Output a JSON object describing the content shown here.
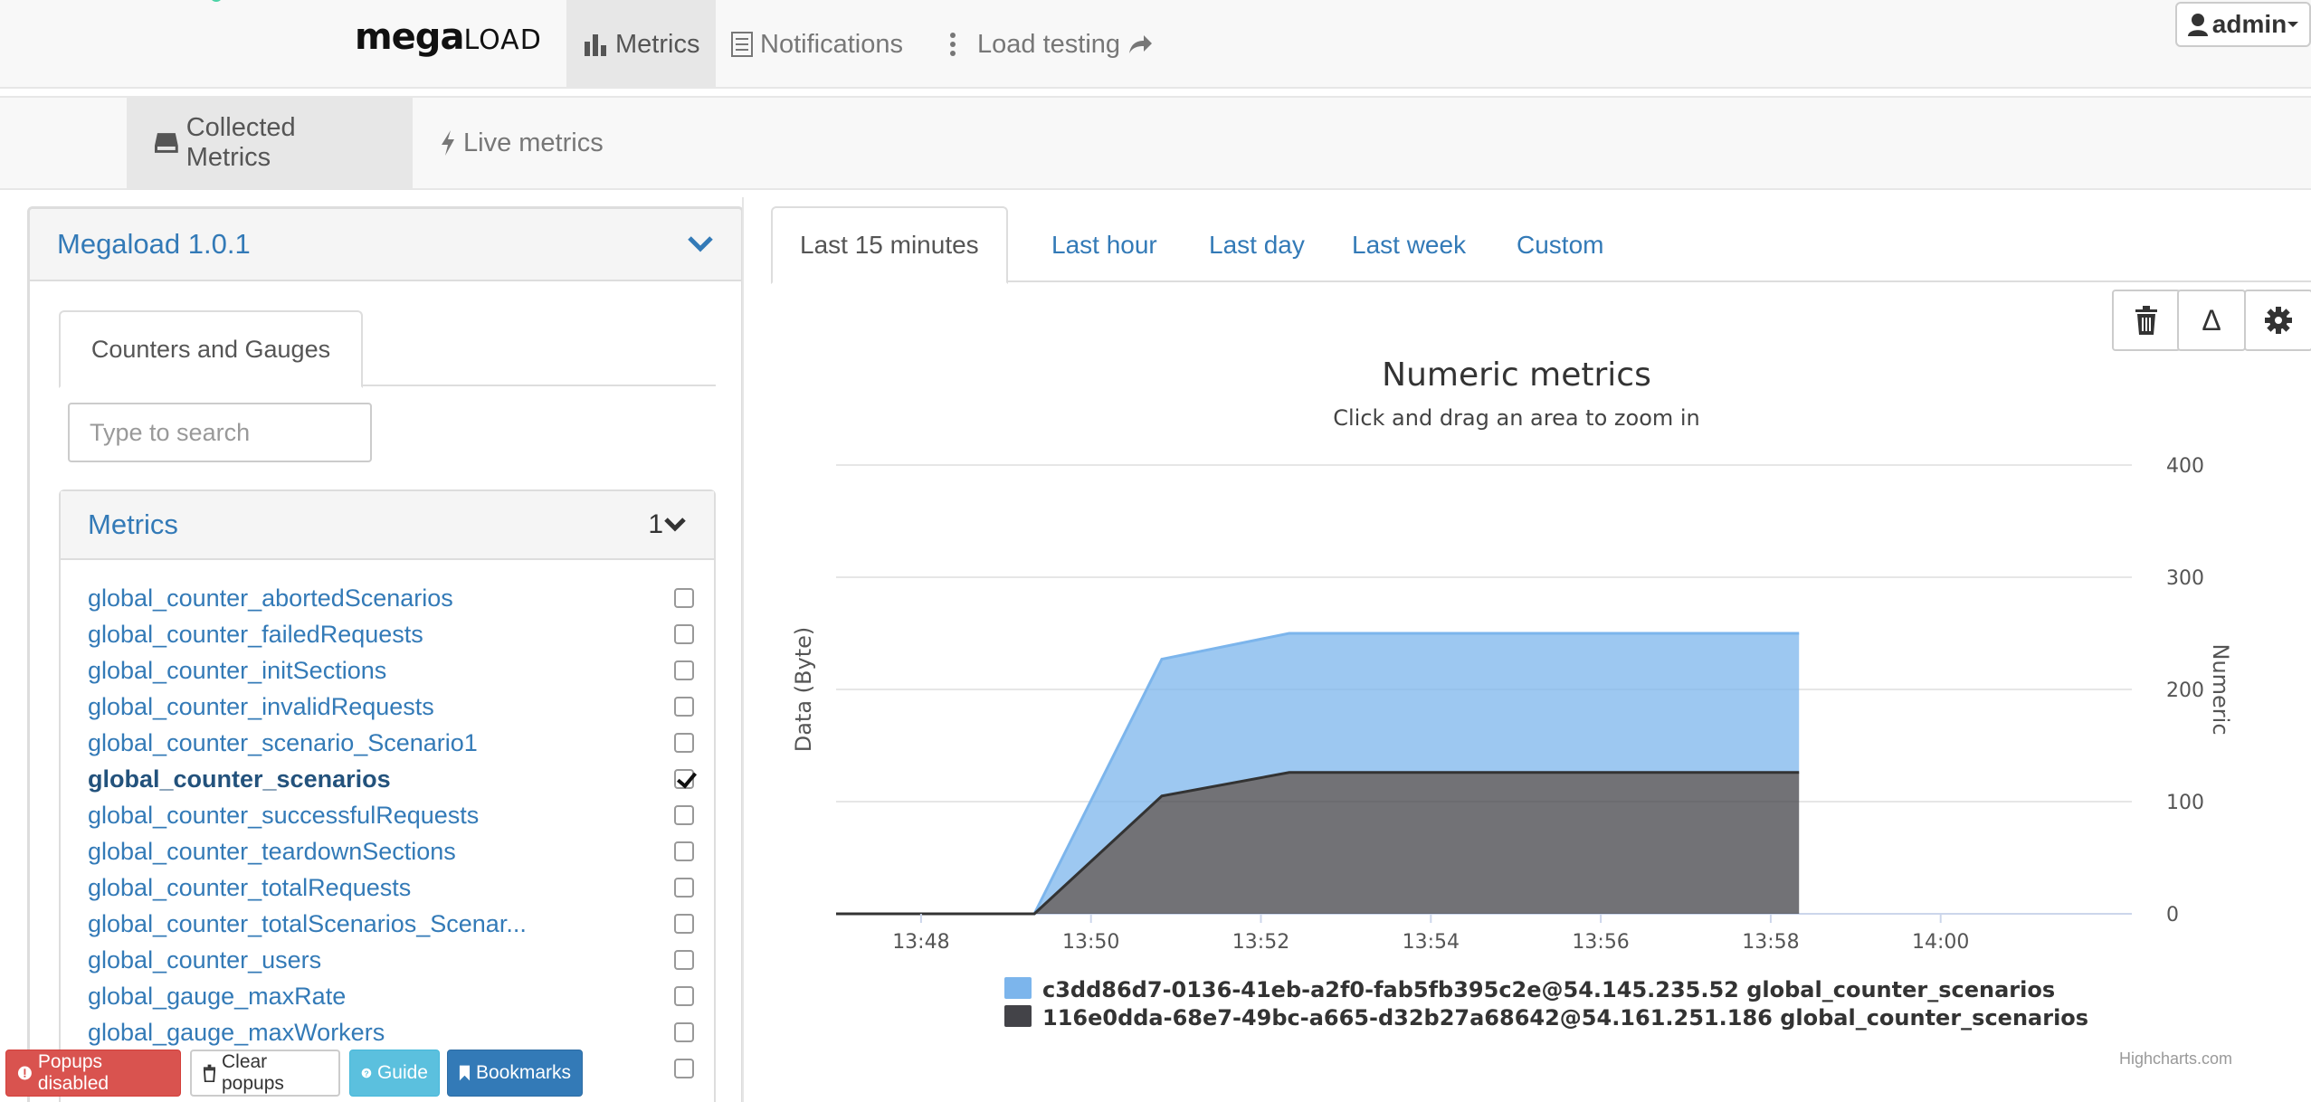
{
  "brand": {
    "bold": "mega",
    "light": "LOAD"
  },
  "nav": {
    "metrics": "Metrics",
    "notifications": "Notifications",
    "load_testing": "Load testing",
    "admin": "admin"
  },
  "subnav": {
    "collected": "Collected Metrics",
    "live": "Live metrics"
  },
  "left": {
    "title": "Megaload  1.0.1",
    "tab": "Counters and Gauges",
    "search_placeholder": "Type to search",
    "metrics_title": "Metrics",
    "metrics_count": "1",
    "metrics": [
      {
        "name": "global_counter_abortedScenarios",
        "checked": false
      },
      {
        "name": "global_counter_failedRequests",
        "checked": false
      },
      {
        "name": "global_counter_initSections",
        "checked": false
      },
      {
        "name": "global_counter_invalidRequests",
        "checked": false
      },
      {
        "name": "global_counter_scenario_Scenario1",
        "checked": false
      },
      {
        "name": "global_counter_scenarios",
        "checked": true
      },
      {
        "name": "global_counter_successfulRequests",
        "checked": false
      },
      {
        "name": "global_counter_teardownSections",
        "checked": false
      },
      {
        "name": "global_counter_totalRequests",
        "checked": false
      },
      {
        "name": "global_counter_totalScenarios_Scenar...",
        "checked": false
      },
      {
        "name": "global_counter_users",
        "checked": false
      },
      {
        "name": "global_gauge_maxRate",
        "checked": false
      },
      {
        "name": "global_gauge_maxWorkers",
        "checked": false
      },
      {
        "name": "",
        "checked": false
      }
    ]
  },
  "buttons": {
    "popups": "Popups disabled",
    "clear": "Clear popups",
    "guide": "Guide",
    "bookmarks": "Bookmarks"
  },
  "time_tabs": [
    "Last 15 minutes",
    "Last hour",
    "Last day",
    "Last week",
    "Custom"
  ],
  "tools": {
    "delta": "Δ"
  },
  "colors": {
    "series1": "#7cb5ec",
    "series2": "#434348",
    "link": "#337ab7",
    "danger": "#d9534f"
  },
  "chart_data": {
    "type": "area",
    "title": "Numeric metrics",
    "subtitle": "Click and drag an area to zoom in",
    "ylabel_left": "Data (Byte)",
    "ylabel_right": "Numeric",
    "y_ticks": [
      0,
      100,
      200,
      300,
      400
    ],
    "ylim": [
      0,
      400
    ],
    "x_ticks": [
      "13:48",
      "13:50",
      "13:52",
      "13:54",
      "13:56",
      "13:58",
      "14:00"
    ],
    "xlim": [
      "13:47:00",
      "14:02:15"
    ],
    "stacked": true,
    "series": [
      {
        "name": "c3dd86d7-0136-41eb-a2f0-fab5fb395c2e@54.145.235.52 global_counter_scenarios",
        "x": [
          "13:47:00",
          "13:49:20",
          "13:50:50",
          "13:52:20",
          "13:58:20"
        ],
        "values": [
          0,
          0,
          122,
          124,
          124
        ]
      },
      {
        "name": "116e0dda-68e7-49bc-a665-d32b27a68642@54.161.251.186 global_counter_scenarios",
        "x": [
          "13:47:00",
          "13:49:20",
          "13:50:50",
          "13:52:20",
          "13:58:20"
        ],
        "values": [
          0,
          0,
          105,
          126,
          126
        ]
      }
    ],
    "credit": "Highcharts.com"
  }
}
